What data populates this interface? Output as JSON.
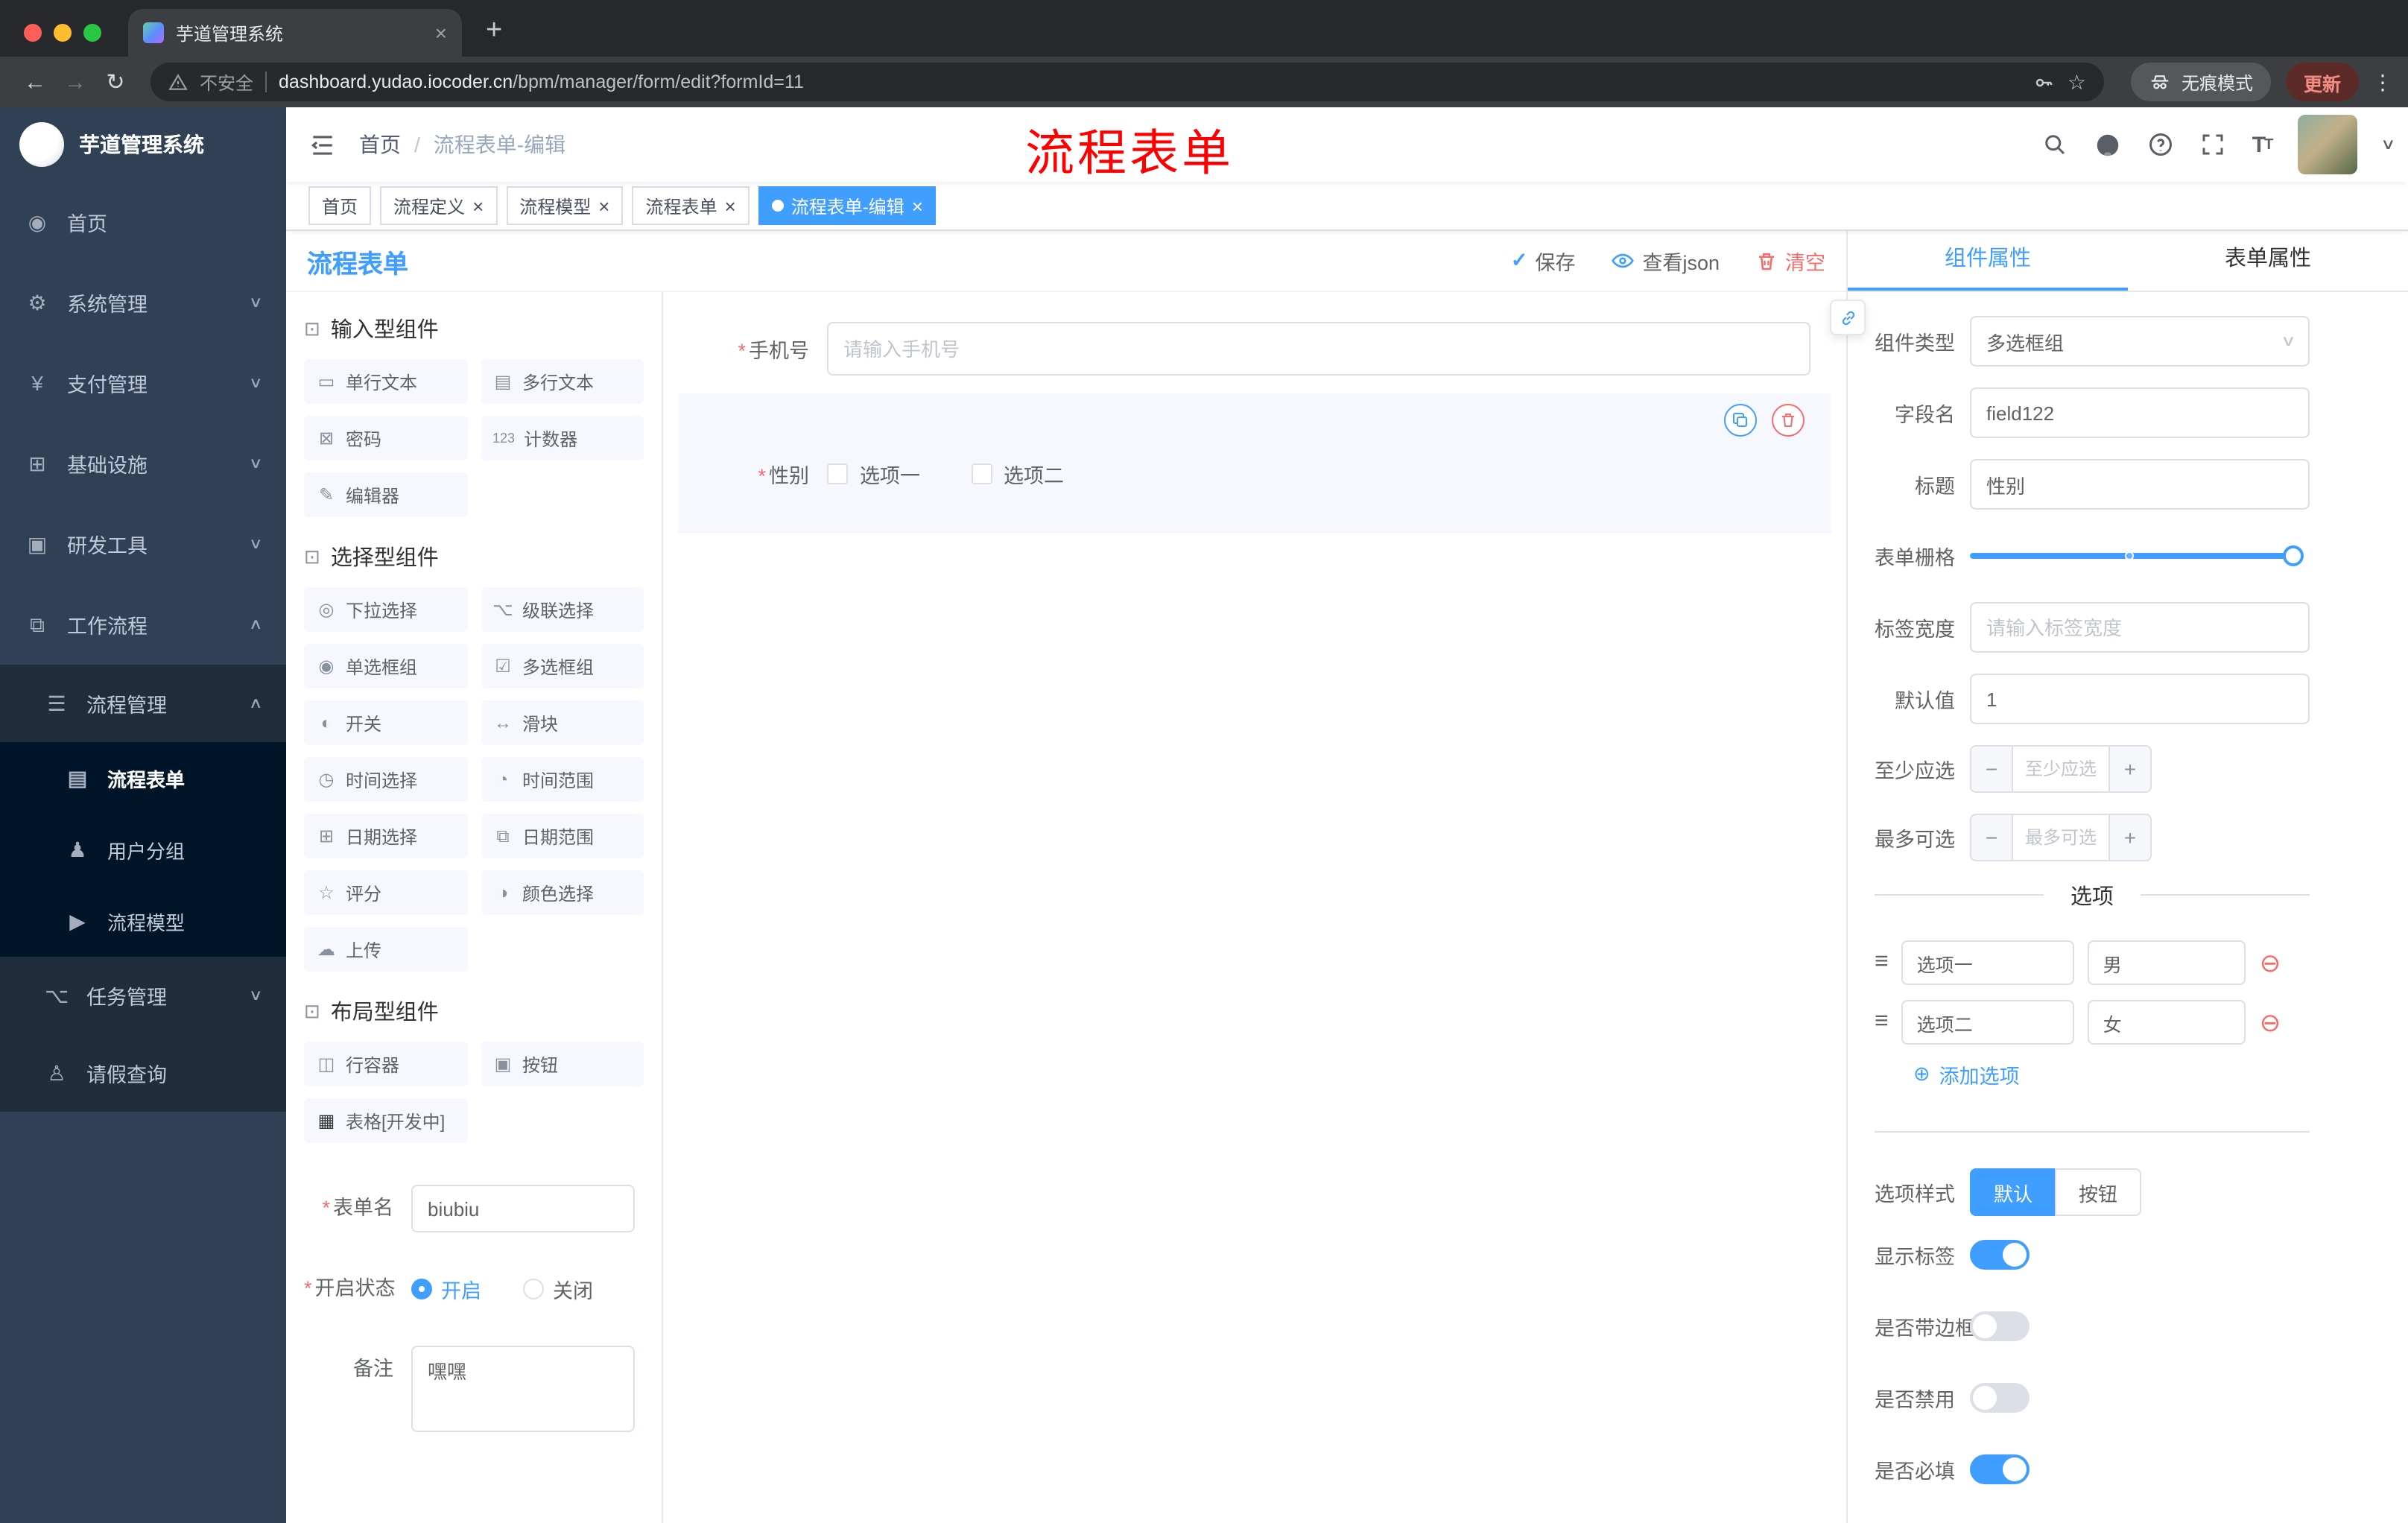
{
  "colors": {
    "accent": "#409EFF",
    "danger": "#F56C6C",
    "sidebar": "#304156",
    "annotation": "#FF0000"
  },
  "glyphs": {
    "close": "×",
    "caret_down": "∨",
    "caret_up": "∧",
    "back": "←",
    "forward": "→",
    "reload": "↻",
    "more": "⋮",
    "star": "☆",
    "check": "✓",
    "new_tab": "+",
    "add_circle": "⊕",
    "remove_circle": "⊖",
    "drag": "≡",
    "required": "*",
    "breadcrumb_sep": "/",
    "question": "?",
    "minus": "−",
    "plus": "+"
  },
  "browser": {
    "tab_title": "芋道管理系统",
    "security_label": "不安全",
    "url_domain": "dashboard.yudao.iocoder.cn",
    "url_path": "/bpm/manager/form/edit?formId=11",
    "incognito_label": "无痕模式",
    "update_label": "更新"
  },
  "sidebar": {
    "logo_title": "芋道管理系统",
    "items": [
      {
        "label": "首页",
        "glyph": "◉"
      },
      {
        "label": "系统管理",
        "glyph": "⚙"
      },
      {
        "label": "支付管理",
        "glyph": "¥"
      },
      {
        "label": "基础设施",
        "glyph": "⊞"
      },
      {
        "label": "研发工具",
        "glyph": "▣"
      },
      {
        "label": "工作流程",
        "glyph": "⧉"
      },
      {
        "label": "流程管理",
        "glyph": "☰"
      },
      {
        "label": "流程表单",
        "glyph": "▤"
      },
      {
        "label": "用户分组",
        "glyph": "♟"
      },
      {
        "label": "流程模型",
        "glyph": "▶"
      },
      {
        "label": "任务管理",
        "glyph": "⌥"
      },
      {
        "label": "请假查询",
        "glyph": "♙"
      }
    ]
  },
  "header": {
    "breadcrumb": [
      "首页",
      "流程表单-编辑"
    ],
    "annotation": "流程表单"
  },
  "tags": [
    {
      "label": "首页"
    },
    {
      "label": "流程定义"
    },
    {
      "label": "流程模型"
    },
    {
      "label": "流程表单"
    },
    {
      "label": "流程表单-编辑"
    }
  ],
  "designer": {
    "title": "流程表单",
    "actions": {
      "save": "保存",
      "view_json": "查看json",
      "clear": "清空"
    }
  },
  "palette": {
    "sections": [
      {
        "title": "输入型组件",
        "items": [
          {
            "label": "单行文本",
            "glyph": "▭"
          },
          {
            "label": "多行文本",
            "glyph": "▤"
          },
          {
            "label": "密码",
            "glyph": "⊠"
          },
          {
            "label": "计数器",
            "glyph": "123"
          },
          {
            "label": "编辑器",
            "glyph": "✎"
          }
        ]
      },
      {
        "title": "选择型组件",
        "items": [
          {
            "label": "下拉选择",
            "glyph": "◎"
          },
          {
            "label": "级联选择",
            "glyph": "⌥"
          },
          {
            "label": "单选框组",
            "glyph": "◉"
          },
          {
            "label": "多选框组",
            "glyph": "☑"
          },
          {
            "label": "开关",
            "glyph": "◐"
          },
          {
            "label": "滑块",
            "glyph": "↔"
          },
          {
            "label": "时间选择",
            "glyph": "◷"
          },
          {
            "label": "时间范围",
            "glyph": "◔"
          },
          {
            "label": "日期选择",
            "glyph": "⊞"
          },
          {
            "label": "日期范围",
            "glyph": "⧉"
          },
          {
            "label": "评分",
            "glyph": "☆"
          },
          {
            "label": "颜色选择",
            "glyph": "◑"
          },
          {
            "label": "上传",
            "glyph": "☁"
          }
        ]
      },
      {
        "title": "布局型组件",
        "items": [
          {
            "label": "行容器",
            "glyph": "◫"
          },
          {
            "label": "按钮",
            "glyph": "▣"
          },
          {
            "label": "表格[开发中]",
            "glyph": "▦"
          }
        ]
      }
    ]
  },
  "form_meta": {
    "name_label": "表单名",
    "name_value": "biubiu",
    "status_label": "开启状态",
    "status_options": [
      "开启",
      "关闭"
    ],
    "status_selected": "开启",
    "remark_label": "备注",
    "remark_value": "嘿嘿"
  },
  "canvas": {
    "fields": [
      {
        "label": "手机号",
        "required": true,
        "placeholder": "请输入手机号"
      },
      {
        "label": "性别",
        "required": true,
        "options": [
          "选项一",
          "选项二"
        ],
        "selected": true
      }
    ]
  },
  "props": {
    "tabs": [
      {
        "label": "组件属性",
        "active": true
      },
      {
        "label": "表单属性",
        "active": false
      }
    ],
    "component_type": {
      "label": "组件类型",
      "value": "多选框组"
    },
    "field_name": {
      "label": "字段名",
      "value": "field122"
    },
    "title": {
      "label": "标题",
      "value": "性别"
    },
    "grid": {
      "label": "表单栅格"
    },
    "label_width": {
      "label": "标签宽度",
      "placeholder": "请输入标签宽度"
    },
    "default_value": {
      "label": "默认值",
      "value": "1"
    },
    "min_select": {
      "label": "至少应选",
      "placeholder": "至少应选"
    },
    "max_select": {
      "label": "最多可选",
      "placeholder": "最多可选"
    },
    "options_section": {
      "title": "选项",
      "rows": [
        {
          "label": "选项一",
          "value": "男"
        },
        {
          "label": "选项二",
          "value": "女"
        }
      ],
      "add_label": "添加选项"
    },
    "style": {
      "label": "选项样式",
      "options": [
        "默认",
        "按钮"
      ],
      "selected": "默认"
    },
    "switches": [
      {
        "label": "显示标签",
        "on": true
      },
      {
        "label": "是否带边框",
        "on": false
      },
      {
        "label": "是否禁用",
        "on": false
      },
      {
        "label": "是否必填",
        "on": true
      }
    ]
  }
}
